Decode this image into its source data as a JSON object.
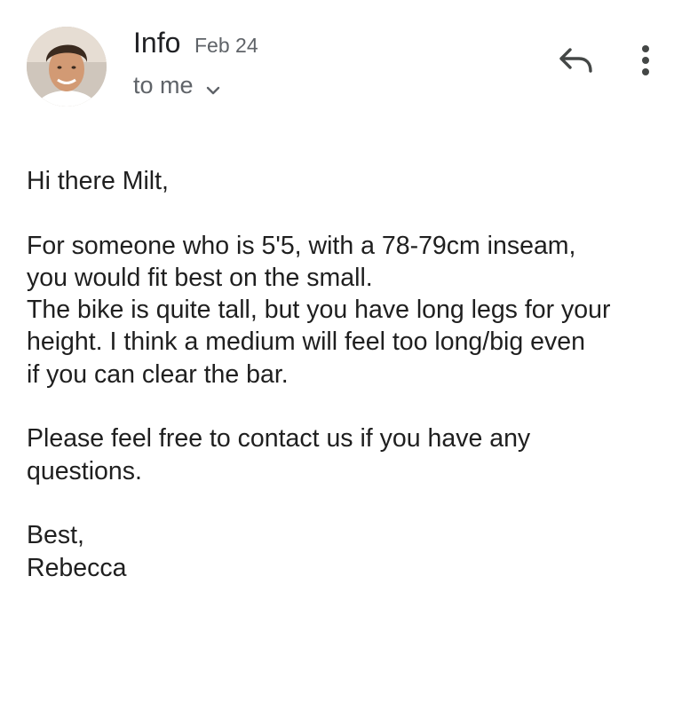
{
  "header": {
    "sender": "Info",
    "date": "Feb 24",
    "recipient": "to me",
    "icons": {
      "avatar": "sender-avatar",
      "chevron": "chevron-down-icon",
      "reply": "reply-icon",
      "more": "more-vert-icon"
    }
  },
  "message": {
    "greeting": "Hi there Milt,",
    "paragraph1": "For someone who is 5'5, with a 78-79cm inseam,\nyou would fit best on the small.\nThe bike is quite tall, but you have long legs for your\nheight. I think a medium will feel too long/big even\nif you can clear the bar.",
    "paragraph2": "Please feel free to contact us if you have any\nquestions.",
    "closing": "Best,",
    "signature": "Rebecca"
  },
  "colors": {
    "primary_text": "#202124",
    "secondary_text": "#5f6368",
    "background": "#ffffff"
  }
}
